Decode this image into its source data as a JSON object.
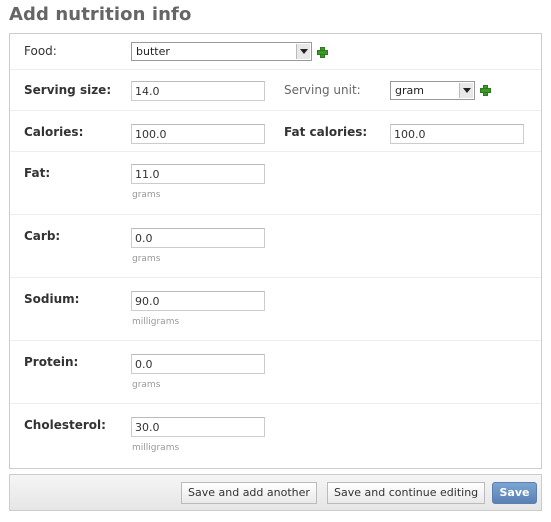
{
  "page": {
    "title": "Add nutrition info"
  },
  "food": {
    "label": "Food:",
    "value": "butter"
  },
  "serving": {
    "size_label": "Serving size:",
    "size_value": "14.0",
    "unit_label": "Serving unit:",
    "unit_value": "gram"
  },
  "calories": {
    "label": "Calories:",
    "value": "100.0",
    "fat_label": "Fat calories:",
    "fat_value": "100.0"
  },
  "fat": {
    "label": "Fat:",
    "value": "11.0",
    "help": "grams"
  },
  "carb": {
    "label": "Carb:",
    "value": "0.0",
    "help": "grams"
  },
  "sodium": {
    "label": "Sodium:",
    "value": "90.0",
    "help": "milligrams"
  },
  "protein": {
    "label": "Protein:",
    "value": "0.0",
    "help": "grams"
  },
  "cholesterol": {
    "label": "Cholesterol:",
    "value": "30.0",
    "help": "milligrams"
  },
  "actions": {
    "save_add": "Save and add another",
    "save_continue": "Save and continue editing",
    "save": "Save"
  },
  "icons": {
    "add": "add-icon",
    "dropdown": "chevron-down-icon"
  },
  "colors": {
    "accent": "#5b80b2",
    "add_icon": "#3a9a25"
  }
}
